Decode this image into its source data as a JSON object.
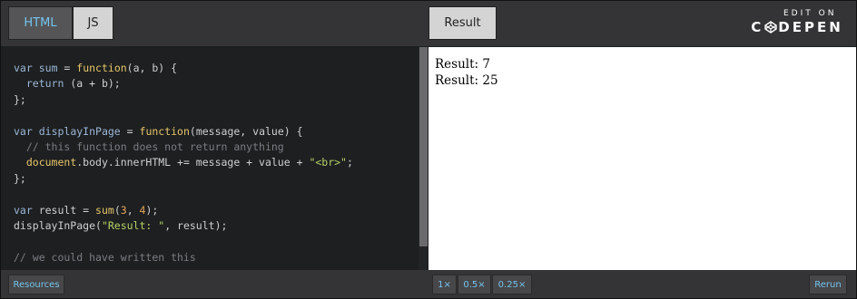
{
  "tabs": {
    "html": "HTML",
    "js": "JS",
    "result": "Result"
  },
  "branding": {
    "edit_on": "EDIT ON",
    "logo_left": "C",
    "logo_right": "DEPEN"
  },
  "code": {
    "lines": [
      "var sum = function(a, b) {",
      "  return (a + b);",
      "};",
      "",
      "var displayInPage = function(message, value) {",
      "  // this function does not return anything",
      "  document.body.innerHTML += message + value + \"<br>\";",
      "};",
      "",
      "var result = sum(3, 4);",
      "displayInPage(\"Result: \", result);",
      "",
      "// we could have written this"
    ]
  },
  "result": {
    "lines": [
      "Result: 7",
      "Result: 25"
    ]
  },
  "bottom": {
    "resources": "Resources",
    "zoom_1": "1×",
    "zoom_05": "0.5×",
    "zoom_025": "0.25×",
    "rerun": "Rerun"
  },
  "colors": {
    "accent": "#75c4ec",
    "bar": "#343436",
    "editor_bg": "#1d1f20"
  },
  "icons": [
    "codepen-cube-icon"
  ]
}
